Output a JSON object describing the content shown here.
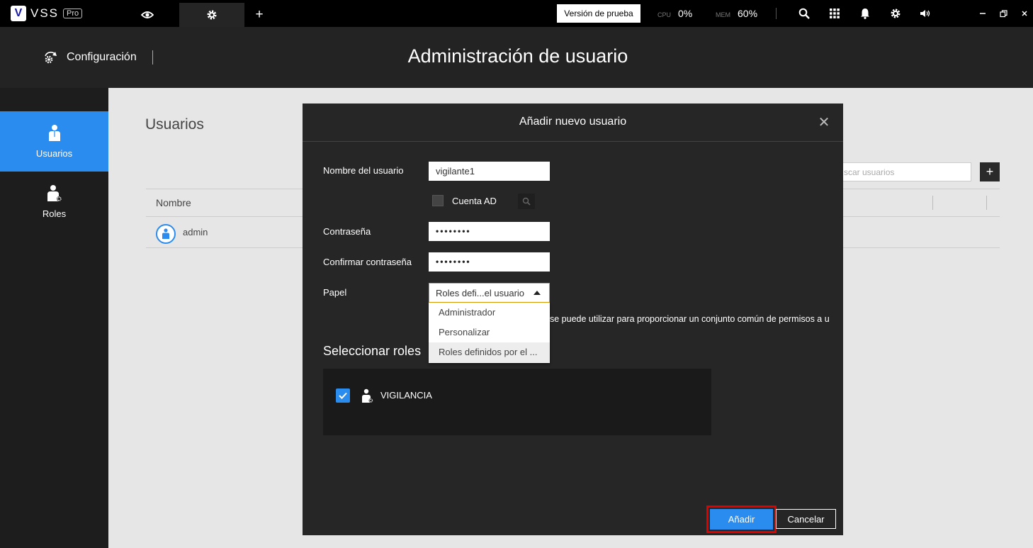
{
  "topbar": {
    "logo_text": "VSS",
    "logo_badge": "Pro",
    "trial_button": "Versión de prueba",
    "cpu_label": "CPU",
    "cpu_value": "0%",
    "mem_label": "MEM",
    "mem_value": "60%"
  },
  "header": {
    "section": "Configuración",
    "title": "Administración de usuario"
  },
  "sidebar": {
    "items": [
      {
        "label": "Usuarios",
        "active": true
      },
      {
        "label": "Roles",
        "active": false
      }
    ]
  },
  "users": {
    "title": "Usuarios",
    "search_placeholder": "scar usuarios",
    "column_name": "Nombre",
    "rows": [
      {
        "name": "admin"
      }
    ]
  },
  "modal": {
    "title": "Añadir nuevo usuario",
    "username_label": "Nombre del usuario",
    "username_value": "vigilante1",
    "ad_label": "Cuenta AD",
    "password_label": "Contraseña",
    "password_value": "••••••••",
    "confirm_label": "Confirmar contraseña",
    "confirm_value": "••••••••",
    "role_label": "Papel",
    "role_selected": "Roles defi...el usuario",
    "role_options": [
      "Administrador",
      "Personalizar",
      "Roles definidos por el ..."
    ],
    "role_description": "se puede utilizar para proporcionar un conjunto común de permisos a u",
    "select_roles_title": "Seleccionar roles",
    "roles": [
      {
        "name": "VIGILANCIA",
        "checked": true
      }
    ],
    "add_button": "Añadir",
    "cancel_button": "Cancelar"
  },
  "colors": {
    "accent": "#2b8cf0",
    "highlight_border": "#e00000",
    "topbar_bg": "#000000",
    "modal_bg": "#262626"
  }
}
